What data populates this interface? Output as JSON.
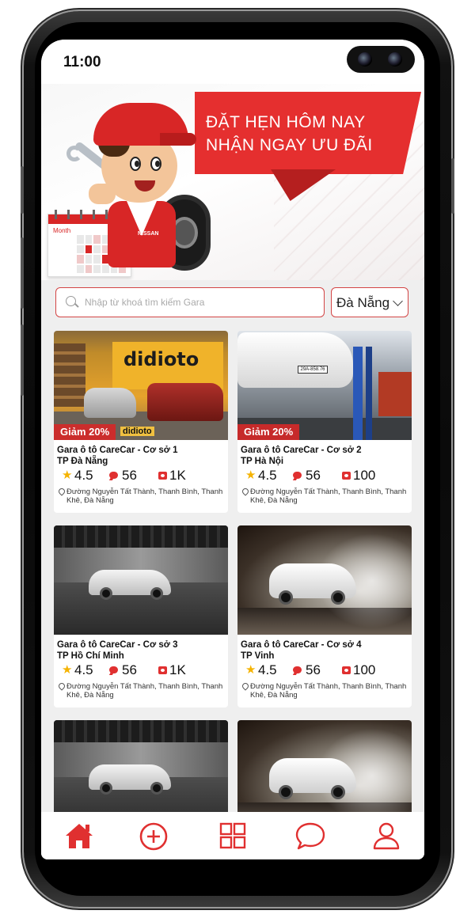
{
  "status_bar": {
    "time": "11:00"
  },
  "banner": {
    "line1": "ĐẶT HẸN HÔM NAY",
    "line2": "NHẬN NGAY ƯU ĐÃI",
    "calendar_label": "Month",
    "mascot_shirt": "NISSAN"
  },
  "search": {
    "placeholder": "Nhập từ khoá tìm kiếm Gara",
    "city": "Đà Nẵng"
  },
  "garages": [
    {
      "title": "Gara ô tô CareCar - Cơ sở 1",
      "city": "TP Đà Nẵng",
      "rating": "4.5",
      "comments": "56",
      "bookings": "1K",
      "address": "Đường Nguyễn Tất Thành, Thanh Bình, Thanh Khê, Đà Nẵng",
      "discount": "Giảm 20%",
      "photo_text": "didioto",
      "photo_badge_text": "didioto"
    },
    {
      "title": "Gara ô tô CareCar - Cơ sở 2",
      "city": "TP Hà Nội",
      "rating": "4.5",
      "comments": "56",
      "bookings": "100",
      "address": "Đường Nguyễn Tất Thành, Thanh Bình, Thanh Khê, Đà Nẵng",
      "discount": "Giảm 20%",
      "photo_text": "29A-858.76"
    },
    {
      "title": "Gara ô tô CareCar - Cơ sở 3",
      "city": "TP Hồ Chí Minh",
      "rating": "4.5",
      "comments": "56",
      "bookings": "1K",
      "address": "Đường Nguyễn Tất Thành, Thanh Bình, Thanh Khê, Đà Nẵng"
    },
    {
      "title": "Gara ô tô CareCar - Cơ sở 4",
      "city": "TP Vinh",
      "rating": "4.5",
      "comments": "56",
      "bookings": "100",
      "address": "Đường Nguyễn Tất Thành, Thanh Bình, Thanh Khê, Đà Nẵng"
    }
  ],
  "nav": {
    "items": [
      "home-icon",
      "plus-circle-icon",
      "grid-icon",
      "chat-icon",
      "user-icon"
    ],
    "active": "home-icon"
  },
  "colors": {
    "accent": "#e03030",
    "ribbon": "#e52f2f",
    "star": "#f5b301"
  }
}
